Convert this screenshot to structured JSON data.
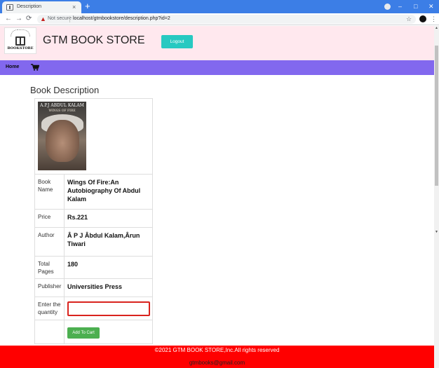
{
  "browser": {
    "tab_title": "Description",
    "tab_close": "×",
    "new_tab": "+",
    "security_label": "Not secure",
    "url": "localhost/gtmbookstore/description.php?id=2",
    "window_minimize": "–",
    "window_maximize": "□",
    "window_close": "✕",
    "back_glyph": "←",
    "forward_glyph": "→",
    "reload_glyph": "⟳",
    "star_glyph": "☆",
    "menu_glyph": "⋮",
    "warning_glyph": "▲"
  },
  "header": {
    "logo_text": "BOOKSTORE",
    "site_title": "GTM BOOK STORE",
    "logout_label": "Logout",
    "bg_color": "#ffe8ee",
    "logout_color": "#27c9c1"
  },
  "nav": {
    "home_label": "Home",
    "cart_icon": "cart-icon",
    "bg_color": "#8268ee"
  },
  "main": {
    "section_title": "Book Description",
    "cover_title": "A.P.J ABDUL KALAM",
    "cover_subtitle": "WINGS OF FIRE",
    "rows": [
      {
        "label": "Book Name",
        "value": "Wings Of Fire:An Autobiography Of Abdul Kalam"
      },
      {
        "label": "Price",
        "value": "Rs.221"
      },
      {
        "label": "Author",
        "value": "Â P J Âbdul Kalam,Ârun Tiwari"
      },
      {
        "label": "Total Pages",
        "value": "180"
      },
      {
        "label": "Publisher",
        "value": "Universities Press"
      },
      {
        "label": "Enter the quantity"
      }
    ],
    "quantity_value": "",
    "add_to_cart_label": "Add To Cart"
  },
  "footer": {
    "copyright": "©2021 GTM BOOK STORE,Inc.All rights reserved",
    "email": "gtmbooks@gmail.com",
    "bg_color": "#ff0000"
  },
  "scrollbar": {
    "up_glyph": "▲",
    "down_glyph": "▼"
  }
}
